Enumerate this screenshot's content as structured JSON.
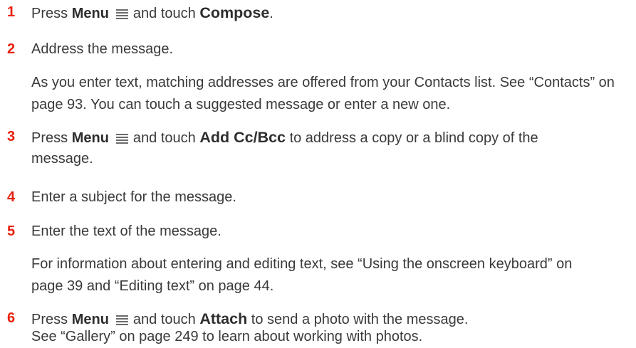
{
  "steps": [
    {
      "number": "1",
      "pre": "Press",
      "menu_label": "Menu",
      "mid": "and touch",
      "command": "Compose",
      "post": "."
    },
    {
      "number": "2",
      "text": "Address the message.",
      "note": "As you enter text, matching addresses are offered from your Contacts list. See “Contacts” on page 93. You can touch a suggested message or enter a new one."
    },
    {
      "number": "3",
      "pre": "Press",
      "menu_label": "Menu",
      "mid": "and touch",
      "command": "Add Cc/Bcc",
      "post": "to address a copy or a blind copy of the",
      "continuation": "message."
    },
    {
      "number": "4",
      "text": "Enter a subject for the message."
    },
    {
      "number": "5",
      "text": "Enter the text of the message.",
      "note": "For information about entering and editing text, see “Using the onscreen keyboard” on page 39 and “Editing text” on page 44."
    },
    {
      "number": "6",
      "pre": "Press",
      "menu_label": "Menu",
      "mid": "and touch",
      "command": "Attach",
      "post": "to send a photo with the message.",
      "note": "See “Gallery” on page 249 to learn about working with photos."
    }
  ],
  "icons": {
    "menu": "menu-icon"
  },
  "colors": {
    "step_number": "#e8200e",
    "text": "#3a3a3a"
  }
}
